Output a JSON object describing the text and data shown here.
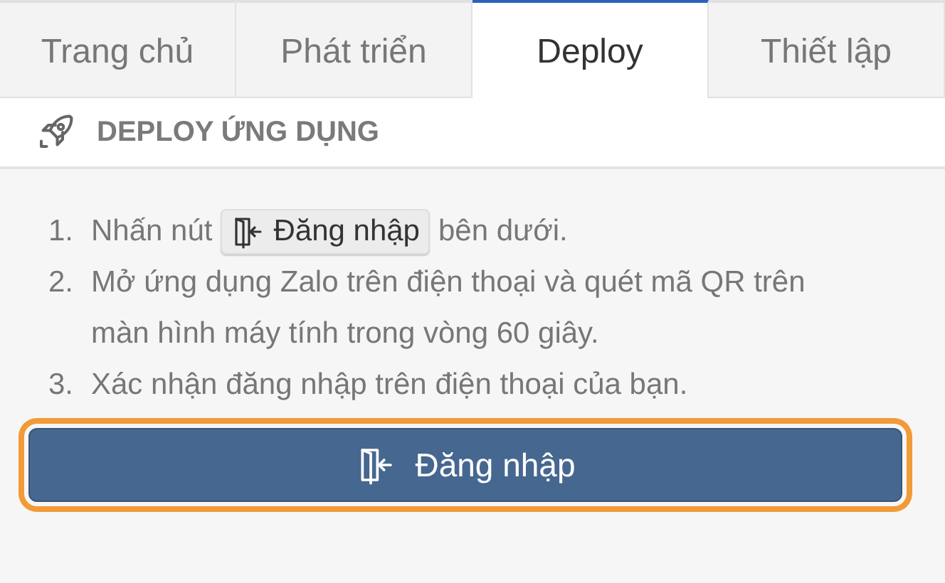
{
  "tabs": [
    {
      "label": "Trang chủ",
      "selected": false
    },
    {
      "label": "Phát triển",
      "selected": false
    },
    {
      "label": "Deploy",
      "selected": true
    },
    {
      "label": "Thiết lập",
      "selected": false
    }
  ],
  "section": {
    "title": "DEPLOY ỨNG DỤNG"
  },
  "steps": [
    {
      "number": "1.",
      "kind": "button",
      "before": "Nhấn nút",
      "button": "Đăng nhập",
      "after": "bên dưới."
    },
    {
      "number": "2.",
      "kind": "text",
      "text": "Mở ứng dụng Zalo trên điện thoại và quét mã QR trên màn hình máy tính trong vòng 60 giây."
    },
    {
      "number": "3.",
      "kind": "text",
      "text": "Xác nhận đăng nhập trên điện thoại của bạn."
    }
  ],
  "login_button": {
    "label": "Đăng nhập",
    "focused": true
  }
}
